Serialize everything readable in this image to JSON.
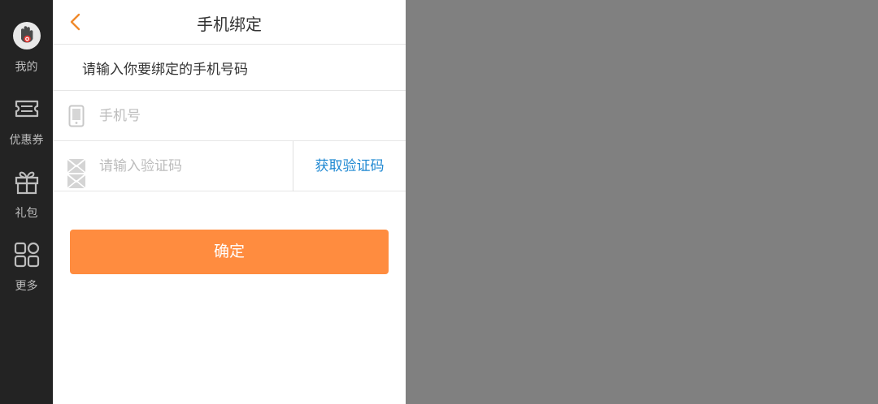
{
  "sidebar": {
    "items": [
      {
        "label": "我的",
        "icon": "hand-logo-icon"
      },
      {
        "label": "优惠券",
        "icon": "coupon-icon"
      },
      {
        "label": "礼包",
        "icon": "gift-icon"
      },
      {
        "label": "更多",
        "icon": "grid-icon"
      }
    ]
  },
  "header": {
    "title": "手机绑定",
    "back_icon": "chevron-left-icon"
  },
  "form": {
    "hint": "请输入你要绑定的手机号码",
    "phone_placeholder": "手机号",
    "code_placeholder": "请输入验证码",
    "get_code_label": "获取验证码",
    "confirm_label": "确定"
  },
  "colors": {
    "sidebar_bg": "#232323",
    "accent_orange": "#ff8c3f",
    "link_blue": "#1e88d2",
    "overlay_gray": "#808080"
  }
}
